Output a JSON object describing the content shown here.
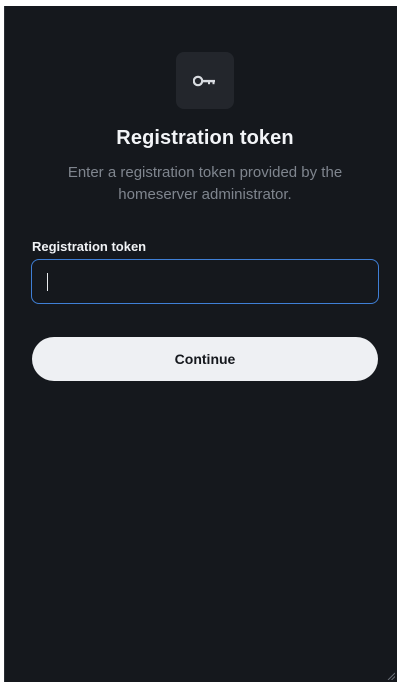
{
  "screen": {
    "icon": "key-icon",
    "title": "Registration token",
    "subtitle": "Enter a registration token provided by the homeserver administrator."
  },
  "form": {
    "token_label": "Registration token",
    "token_value": "",
    "token_placeholder": "",
    "continue_label": "Continue"
  },
  "colors": {
    "background": "#15181d",
    "accent_border": "#3f7fd6",
    "button_bg": "#eef0f3"
  }
}
